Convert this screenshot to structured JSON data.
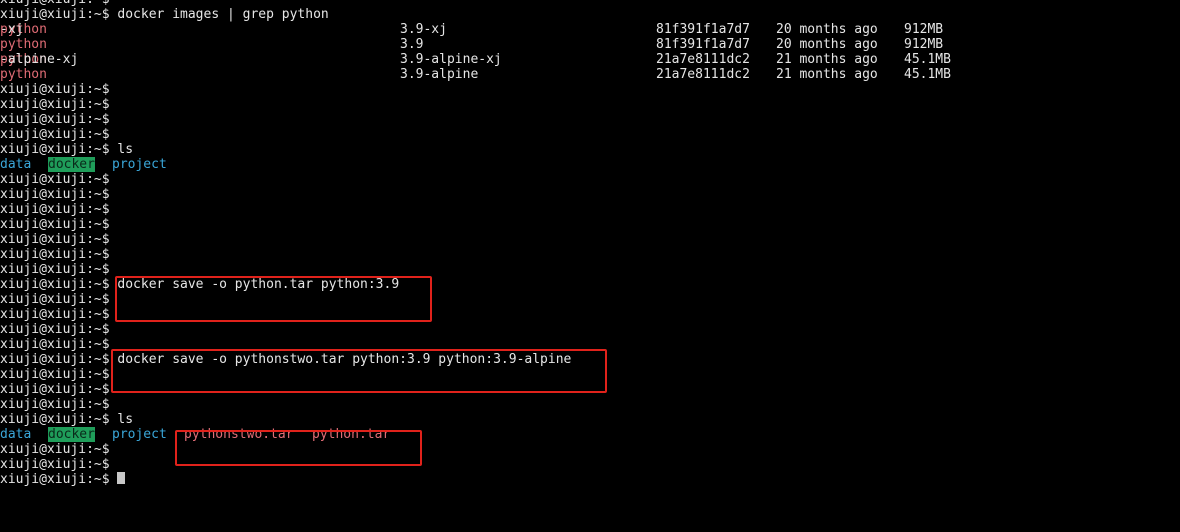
{
  "terminal": {
    "prompt": "xiuji@xiuji:~$",
    "cmd_images": "docker images | grep python",
    "images": [
      {
        "name_hl": "python",
        "name_rest": "-xj",
        "tag": "3.9-xj",
        "id": "81f391f1a7d7",
        "created": "20 months ago",
        "size": "912MB"
      },
      {
        "name_hl": "python",
        "name_rest": "",
        "tag": "3.9",
        "id": "81f391f1a7d7",
        "created": "20 months ago",
        "size": "912MB"
      },
      {
        "name_hl": "python",
        "name_rest": "-alpine-xj",
        "tag": "3.9-alpine-xj",
        "id": "21a7e8111dc2",
        "created": "21 months ago",
        "size": "45.1MB"
      },
      {
        "name_hl": "python",
        "name_rest": "",
        "tag": "3.9-alpine",
        "id": "21a7e8111dc2",
        "created": "21 months ago",
        "size": "45.1MB"
      }
    ],
    "cmd_ls": "ls",
    "ls1": {
      "data": "data",
      "docker": "docker",
      "project": "project"
    },
    "cmd_save1": "docker save -o python.tar python:3.9",
    "cmd_save2": "docker save -o pythonstwo.tar python:3.9 python:3.9-alpine",
    "ls2": {
      "data": "data",
      "docker": "docker",
      "project": "project",
      "file1": "pythonstwo.tar",
      "file2": "python.tar"
    }
  },
  "colors": {
    "background": "#000000",
    "text": "#e6e6e6",
    "grep_highlight": "#e06c75",
    "directory": "#3aa6d8",
    "sticky_dir_bg": "#1f9e5a",
    "annotation_box": "#e0221b"
  }
}
